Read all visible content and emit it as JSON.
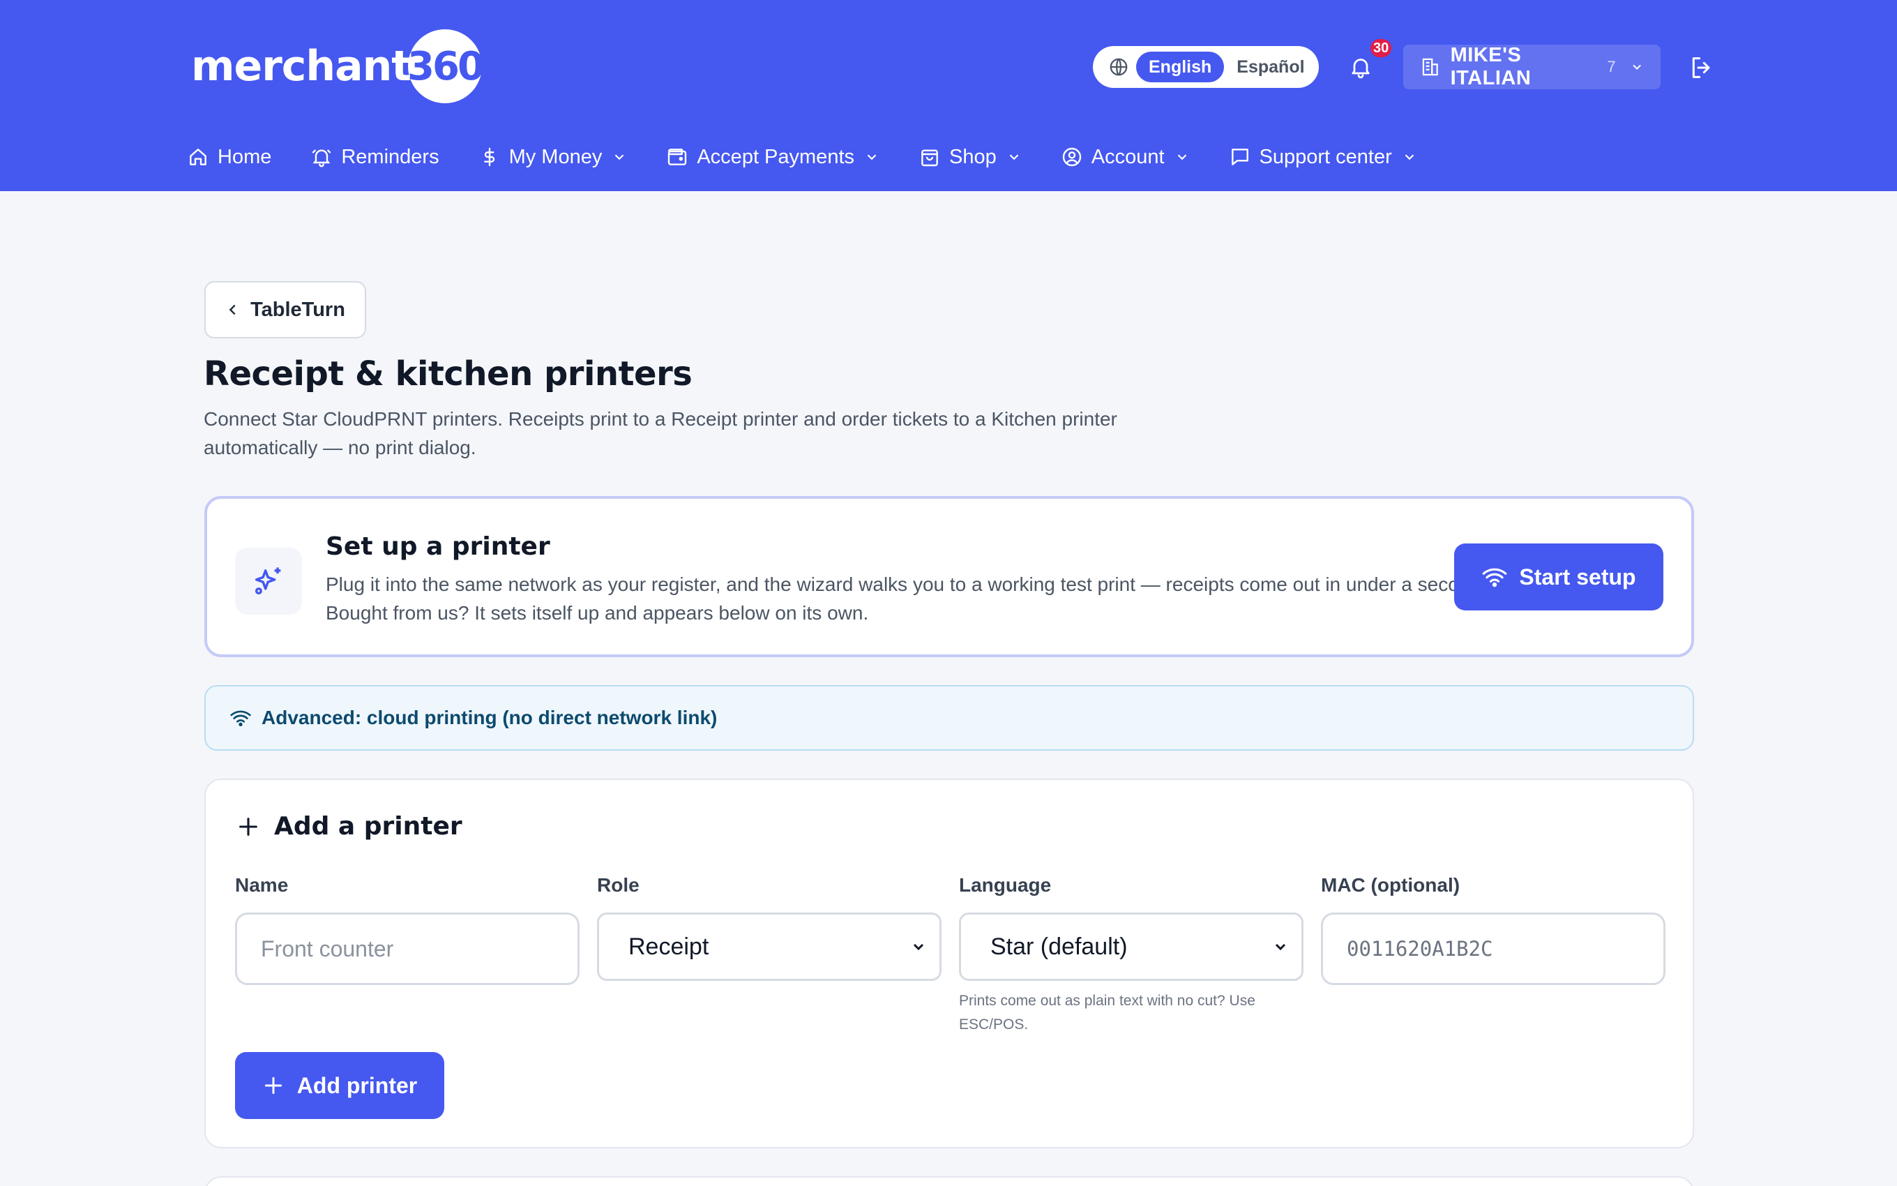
{
  "header": {
    "logo_text": "merchant",
    "logo_badge": "360",
    "language": {
      "active": "English",
      "inactive": "Español"
    },
    "notifications_count": "30",
    "merchant": {
      "name": "MIKE'S ITALIAN",
      "count": "7"
    },
    "brand_color": "#4558ef"
  },
  "nav": {
    "items": [
      {
        "label": "Home",
        "icon": "home-icon"
      },
      {
        "label": "Reminders",
        "icon": "bell-icon"
      },
      {
        "label": "My Money",
        "icon": "dollar-icon"
      },
      {
        "label": "Accept Payments",
        "icon": "wallet-icon"
      },
      {
        "label": "Shop",
        "icon": "shopping-bag-icon"
      },
      {
        "label": "Account",
        "icon": "user-circle-icon"
      },
      {
        "label": "Support center",
        "icon": "chat-icon"
      }
    ]
  },
  "page": {
    "back_label": "TableTurn",
    "title": "Receipt & kitchen printers",
    "description": "Connect Star CloudPRNT printers. Receipts print to a Receipt printer and order tickets to a Kitchen printer automatically — no print dialog."
  },
  "setup": {
    "title": "Set up a printer",
    "description": "Plug it into the same network as your register, and the wizard walks you to a working test print — receipts come out in under a second. Bought from us? It sets itself up and appears below on its own.",
    "button": "Start setup"
  },
  "advanced": {
    "label": "Advanced: cloud printing (no direct network link)"
  },
  "add_printer": {
    "title": "Add a printer",
    "name": {
      "label": "Name",
      "placeholder": "Front counter"
    },
    "role": {
      "label": "Role",
      "value": "Receipt"
    },
    "language": {
      "label": "Language",
      "value": "Star (default)",
      "hint": "Prints come out as plain text with no cut? Use ESC/POS."
    },
    "mac": {
      "label": "MAC (optional)",
      "placeholder": "0011620A1B2C"
    },
    "button": "Add printer"
  }
}
